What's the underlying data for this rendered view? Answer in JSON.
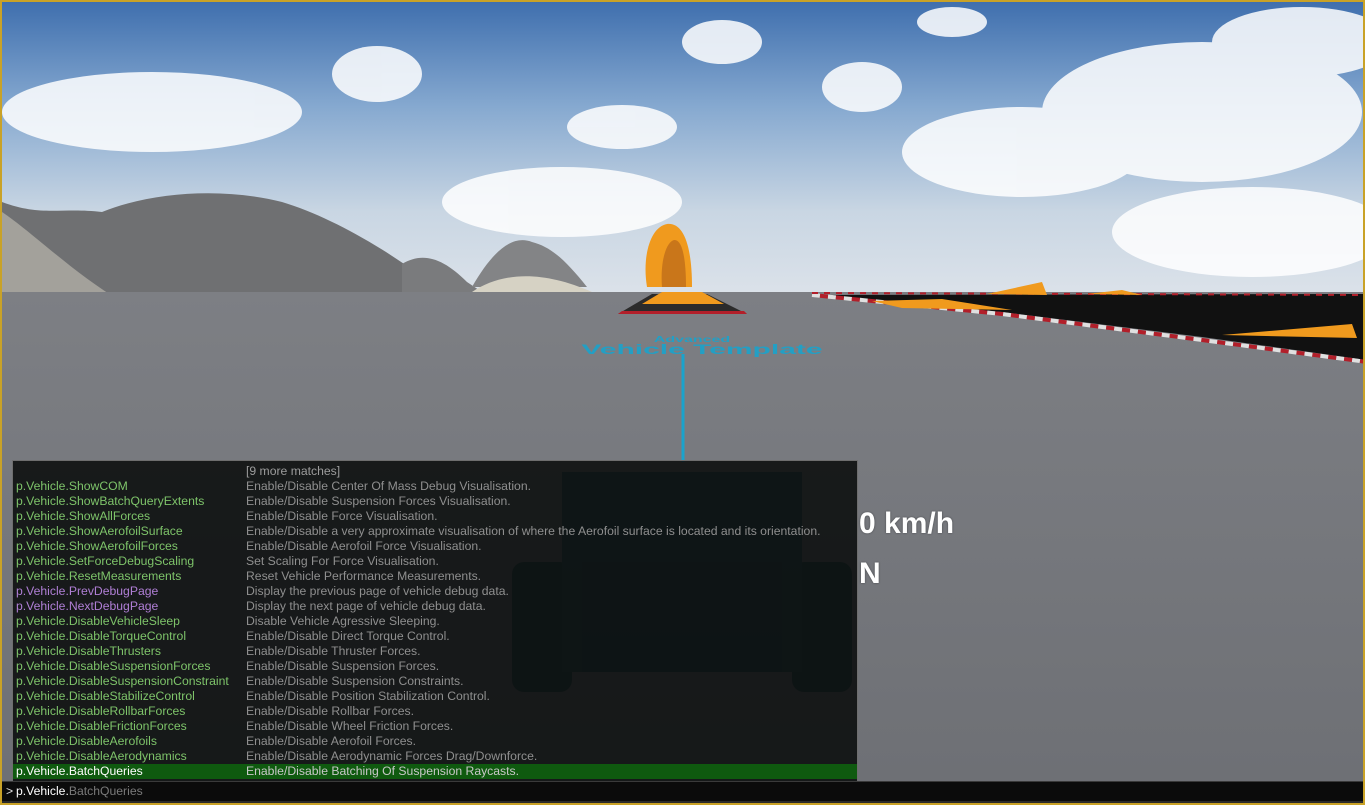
{
  "hud": {
    "speed": "0 km/h",
    "gear": "N"
  },
  "world": {
    "floor_text_line1": "Advanced",
    "floor_text_line2": "Vehicle Template"
  },
  "colors": {
    "frame_border": "#c9a227",
    "command_default": "#7ec46a",
    "command_debug_page": "#b07fd6",
    "selected_row": "#0f5a0f",
    "ramp_orange": "#f09a1e",
    "floor_text_cyan": "#1aa3cc"
  },
  "console": {
    "more_matches": "[9 more matches]",
    "matches": [
      {
        "command": "p.Vehicle.ShowCOM",
        "description": "Enable/Disable Center Of Mass Debug Visualisation.",
        "color": "#7ec46a"
      },
      {
        "command": "p.Vehicle.ShowBatchQueryExtents",
        "description": "Enable/Disable Suspension Forces Visualisation.",
        "color": "#7ec46a"
      },
      {
        "command": "p.Vehicle.ShowAllForces",
        "description": "Enable/Disable Force Visualisation.",
        "color": "#7ec46a"
      },
      {
        "command": "p.Vehicle.ShowAerofoilSurface",
        "description": "Enable/Disable a very approximate visualisation of where the Aerofoil surface is located and its orientation.",
        "color": "#7ec46a"
      },
      {
        "command": "p.Vehicle.ShowAerofoilForces",
        "description": "Enable/Disable Aerofoil Force Visualisation.",
        "color": "#7ec46a"
      },
      {
        "command": "p.Vehicle.SetForceDebugScaling",
        "description": "Set Scaling For Force Visualisation.",
        "color": "#7ec46a"
      },
      {
        "command": "p.Vehicle.ResetMeasurements",
        "description": "Reset Vehicle Performance Measurements.",
        "color": "#7ec46a"
      },
      {
        "command": "p.Vehicle.PrevDebugPage",
        "description": "Display the previous page of vehicle debug data.",
        "color": "#b07fd6"
      },
      {
        "command": "p.Vehicle.NextDebugPage",
        "description": "Display the next page of vehicle debug data.",
        "color": "#b07fd6"
      },
      {
        "command": "p.Vehicle.DisableVehicleSleep",
        "description": "Disable Vehicle Agressive Sleeping.",
        "color": "#7ec46a"
      },
      {
        "command": "p.Vehicle.DisableTorqueControl",
        "description": "Enable/Disable Direct Torque Control.",
        "color": "#7ec46a"
      },
      {
        "command": "p.Vehicle.DisableThrusters",
        "description": "Enable/Disable Thruster Forces.",
        "color": "#7ec46a"
      },
      {
        "command": "p.Vehicle.DisableSuspensionForces",
        "description": "Enable/Disable Suspension Forces.",
        "color": "#7ec46a"
      },
      {
        "command": "p.Vehicle.DisableSuspensionConstraint",
        "description": "Enable/Disable Suspension Constraints.",
        "color": "#7ec46a"
      },
      {
        "command": "p.Vehicle.DisableStabilizeControl",
        "description": "Enable/Disable Position Stabilization Control.",
        "color": "#7ec46a"
      },
      {
        "command": "p.Vehicle.DisableRollbarForces",
        "description": "Enable/Disable Rollbar Forces.",
        "color": "#7ec46a"
      },
      {
        "command": "p.Vehicle.DisableFrictionForces",
        "description": "Enable/Disable Wheel Friction Forces.",
        "color": "#7ec46a"
      },
      {
        "command": "p.Vehicle.DisableAerofoils",
        "description": "Enable/Disable Aerofoil Forces.",
        "color": "#7ec46a"
      },
      {
        "command": "p.Vehicle.DisableAerodynamics",
        "description": "Enable/Disable Aerodynamic Forces Drag/Downforce.",
        "color": "#7ec46a"
      },
      {
        "command": "p.Vehicle.BatchQueries",
        "description": "Enable/Disable Batching Of Suspension Raycasts.",
        "color": "#ffffff",
        "selected": true
      }
    ],
    "prompt": ">",
    "input_value": "p.Vehicle.",
    "input_suggestion": "BatchQueries"
  }
}
